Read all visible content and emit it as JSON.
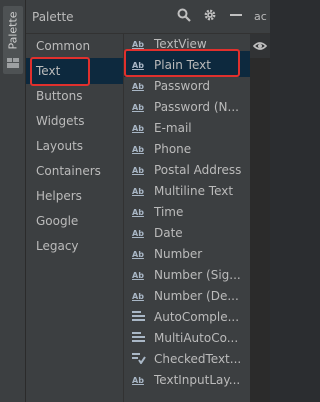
{
  "side_tab": {
    "label": "Palette"
  },
  "header": {
    "title": "Palette"
  },
  "categories": [
    "Common",
    "Text",
    "Buttons",
    "Widgets",
    "Layouts",
    "Containers",
    "Helpers",
    "Google",
    "Legacy"
  ],
  "items": [
    "TextView",
    "Plain Text",
    "Password",
    "Password (N...",
    "E-mail",
    "Phone",
    "Postal Address",
    "Multiline Text",
    "Time",
    "Date",
    "Number",
    "Number (Sig...",
    "Number (De...",
    "AutoComple...",
    "MultiAutoCo...",
    "CheckedText...",
    "TextInputLay..."
  ],
  "item_icon_text": "Ab",
  "right_tab": {
    "label": "ac"
  },
  "colors": {
    "accent_selection": "#0d293e",
    "highlight_box": "#e0302d",
    "panel_bg": "#3c3f41"
  }
}
